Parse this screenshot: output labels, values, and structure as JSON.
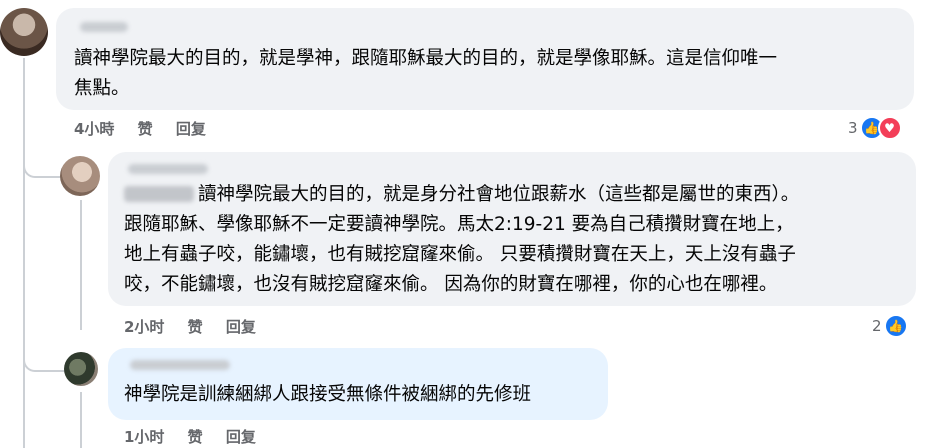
{
  "comments": [
    {
      "text": "讀神學院最大的目的，就是學神，跟隨耶穌最大的目的，就是學像耶穌。這是信仰唯一\n焦點。",
      "time": "4小時",
      "like_label": "赞",
      "reply_label": "回复",
      "reaction_count": "3",
      "reactions": [
        "like-icon",
        "love-icon"
      ]
    },
    {
      "text": "讀神學院最大的目的，就是身分社會地位跟薪水（這些都是屬世的東西）。\n跟隨耶穌、學像耶穌不一定要讀神學院。馬太2:19-21 要為自己積攢財寶在地上，\n地上有蟲子咬，能鏽壞，也有賊挖窟窿來偷。 只要積攢財寶在天上，天上沒有蟲子\n咬，不能鏽壞，也沒有賊挖窟窿來偷。 因為你的財寶在哪裡，你的心也在哪裡。",
      "time": "2小时",
      "like_label": "赞",
      "reply_label": "回复",
      "reaction_count": "2",
      "reactions": [
        "like-icon"
      ]
    },
    {
      "text": "神學院是訓練綑綁人跟接受無條件被綑綁的先修班",
      "time": "1小时",
      "like_label": "赞",
      "reply_label": "回复"
    }
  ],
  "colors": {
    "bubble": "#f0f2f5",
    "bubble_highlight": "#e7f3ff",
    "meta_text": "#65676b",
    "like": "#1877f2",
    "love": "#f33e58"
  }
}
